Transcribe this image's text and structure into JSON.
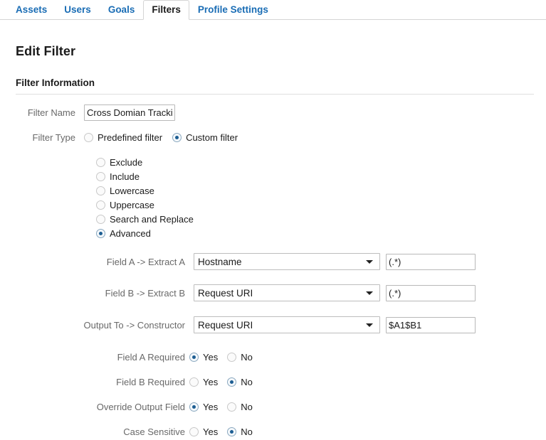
{
  "tabs": [
    {
      "label": "Assets",
      "active": false
    },
    {
      "label": "Users",
      "active": false
    },
    {
      "label": "Goals",
      "active": false
    },
    {
      "label": "Filters",
      "active": true
    },
    {
      "label": "Profile Settings",
      "active": false
    }
  ],
  "page": {
    "title": "Edit Filter",
    "section_title": "Filter Information"
  },
  "filter_name": {
    "label": "Filter Name",
    "value": "Cross Domian Trackin",
    "placeholder": ""
  },
  "filter_type": {
    "label": "Filter Type",
    "options": [
      {
        "label": "Predefined filter",
        "selected": false
      },
      {
        "label": "Custom filter",
        "selected": true
      }
    ]
  },
  "filter_kind": {
    "options": [
      {
        "label": "Exclude",
        "selected": false
      },
      {
        "label": "Include",
        "selected": false
      },
      {
        "label": "Lowercase",
        "selected": false
      },
      {
        "label": "Uppercase",
        "selected": false
      },
      {
        "label": "Search and Replace",
        "selected": false
      },
      {
        "label": "Advanced",
        "selected": true
      }
    ]
  },
  "advanced": {
    "field_a": {
      "label": "Field A -> Extract A",
      "select_value": "Hostname",
      "extract_value": "(.*)"
    },
    "field_b": {
      "label": "Field B -> Extract B",
      "select_value": "Request URI",
      "extract_value": "(.*)"
    },
    "output": {
      "label": "Output To -> Constructor",
      "select_value": "Request URI",
      "constructor_value": "$A1$B1"
    },
    "yes_label": "Yes",
    "no_label": "No",
    "toggles": [
      {
        "label": "Field A Required",
        "value": "Yes"
      },
      {
        "label": "Field B Required",
        "value": "No"
      },
      {
        "label": "Override Output Field",
        "value": "Yes"
      },
      {
        "label": "Case Sensitive",
        "value": "No"
      }
    ]
  },
  "colors": {
    "tab_link": "#1a6db5",
    "label_gray": "#696969",
    "radio_dot": "#1c5d92",
    "border": "#bdbdbd"
  }
}
